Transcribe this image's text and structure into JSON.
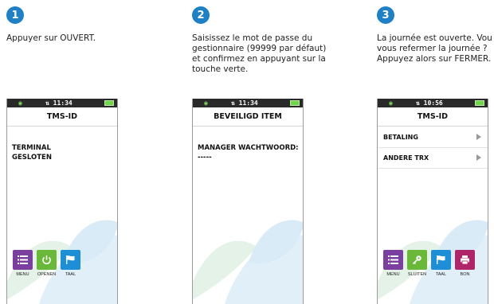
{
  "steps": [
    {
      "number": "1",
      "instruction": "Appuyer sur OUVERT.",
      "device": {
        "time": "11:34",
        "title": "TMS-ID",
        "message": "TERMINAL\nGESLOTEN",
        "tiles": [
          {
            "label": "MENU",
            "color": "#7b3fa0",
            "icon": "list-icon"
          },
          {
            "label": "OPENEN",
            "color": "#69b83a",
            "icon": "power-icon"
          },
          {
            "label": "TAAL",
            "color": "#1e8fd6",
            "icon": "flag-icon"
          }
        ]
      }
    },
    {
      "number": "2",
      "instruction": "Saisissez le mot de passe du\ngestionnaire (99999 par défaut)\net confirmez en appuyant sur la\ntouche verte.",
      "device": {
        "time": "11:34",
        "title": "BEVEILIGD ITEM",
        "message": "MANAGER WACHTWOORD:\n-----"
      }
    },
    {
      "number": "3",
      "instruction": "La journée est ouverte. Vou\nvous refermer la journée ?\nAppuyez alors sur FERMER.",
      "device": {
        "time": "10:56",
        "title": "TMS-ID",
        "menu": [
          "BETALING",
          "ANDERE TRX"
        ],
        "tiles": [
          {
            "label": "MENU",
            "color": "#7b3fa0",
            "icon": "list-icon"
          },
          {
            "label": "SLUITEN",
            "color": "#69b83a",
            "icon": "key-icon"
          },
          {
            "label": "TAAL",
            "color": "#1e8fd6",
            "icon": "flag-icon"
          },
          {
            "label": "BON",
            "color": "#b0246a",
            "icon": "printer-icon"
          }
        ]
      }
    }
  ]
}
